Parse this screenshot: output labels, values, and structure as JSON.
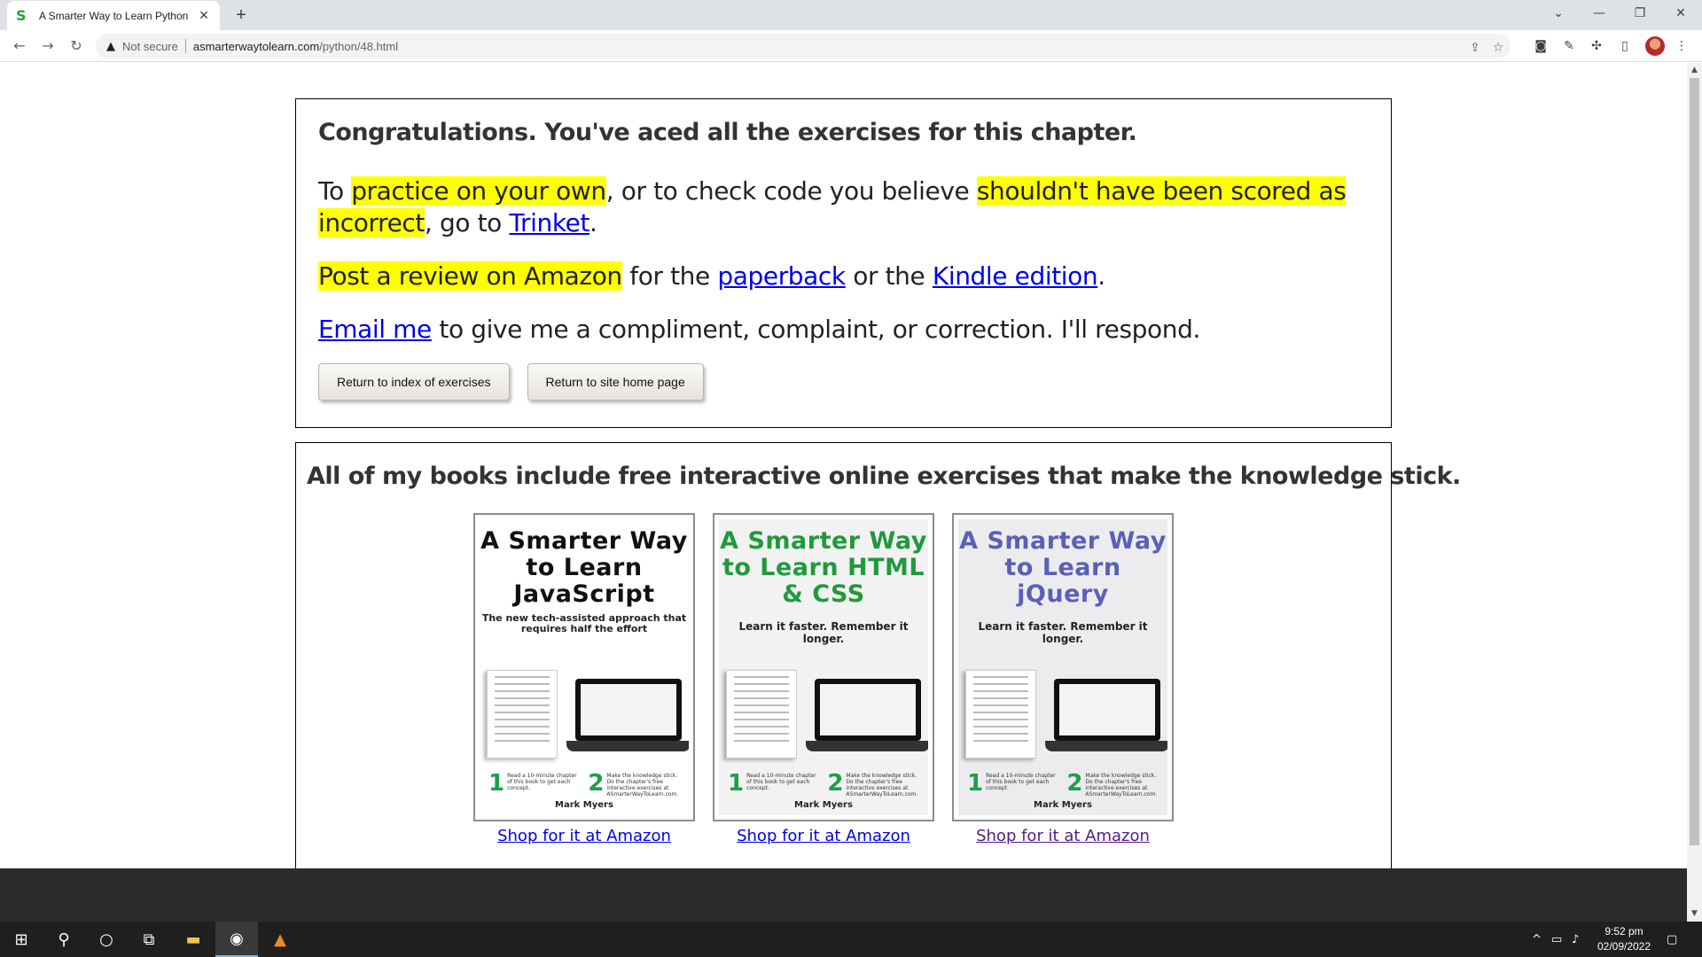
{
  "browser": {
    "tab_title": "A Smarter Way to Learn Python",
    "tab_favicon": "S",
    "tab_close": "✕",
    "new_tab": "+",
    "security_label": "Not secure",
    "url_host": "asmarterwaytolearn.com",
    "url_path": "/python/48.html",
    "icons": [
      "back-arrow-icon",
      "forward-arrow-icon",
      "reload-icon",
      "warning-icon",
      "share-icon",
      "star-icon",
      "extension-icon",
      "puzzle-icon",
      "sidebar-icon",
      "profile-avatar",
      "menu-icon"
    ]
  },
  "congrats": {
    "heading": "Congratulations. You've aced all the exercises for this chapter.",
    "p1_a": "To ",
    "p1_hl1": "practice on your own",
    "p1_b": ", or to check code you believe ",
    "p1_hl2": "shouldn't have been scored as incorrect",
    "p1_c": ", go to ",
    "p1_link": "Trinket",
    "p1_end": ".",
    "p2_hl": "Post a review on Amazon",
    "p2_a": " for the ",
    "p2_link1": "paperback",
    "p2_b": " or the ",
    "p2_link2": "Kindle edition",
    "p2_end": ".",
    "p3_link": "Email me",
    "p3_a": " to give me a compliment, complaint, or correction. I'll respond.",
    "btn_index": "Return to index of exercises",
    "btn_home": "Return to site home page"
  },
  "books": {
    "heading": "All of my books include free interactive online exercises that make the knowledge stick.",
    "items": [
      {
        "title": "A Smarter Way to Learn JavaScript",
        "subtitle": "The new tech-assisted approach that requires half the effort",
        "tagline": "",
        "step1": "Read a 10-minute chapter of this book to get each concept.",
        "step2": "Make the knowledge stick. Do the chapter's free interactive exercises at ASmarterWayToLearn.com.",
        "author": "Mark Myers",
        "link": "Shop for it at Amazon",
        "title_color": "#111111",
        "bg": "#ffffff"
      },
      {
        "title": "A Smarter Way to Learn HTML & CSS",
        "subtitle": "",
        "tagline": "Learn it faster. Remember it longer.",
        "step1": "Read a 10-minute chapter of this book to get each concept.",
        "step2": "Make the knowledge stick. Do the chapter's free interactive exercises at ASmarterWayToLearn.com.",
        "author": "Mark Myers",
        "link": "Shop for it at Amazon",
        "title_color": "#1f9a3c",
        "bg": "#f2f2f2"
      },
      {
        "title": "A Smarter Way to Learn jQuery",
        "subtitle": "",
        "tagline": "Learn it faster. Remember it longer.",
        "step1": "Read a 10-minute chapter of this book to get each concept.",
        "step2": "Make the knowledge stick. Do the chapter's free interactive exercises at ASmarterWayToLearn.com.",
        "author": "Mark Myers",
        "link": "Shop for it at Amazon",
        "title_color": "#5a5fb8",
        "bg": "#ececee"
      }
    ]
  },
  "taskbar": {
    "time": "9:52 pm",
    "date": "02/09/2022",
    "icons": [
      "windows-start-icon",
      "search-icon",
      "cortana-icon",
      "task-view-icon",
      "file-explorer-icon",
      "chrome-icon",
      "vlc-icon"
    ]
  },
  "colors": {
    "highlight": "#ffff00",
    "link": "#0000ee",
    "visited_link": "#551a8b"
  }
}
